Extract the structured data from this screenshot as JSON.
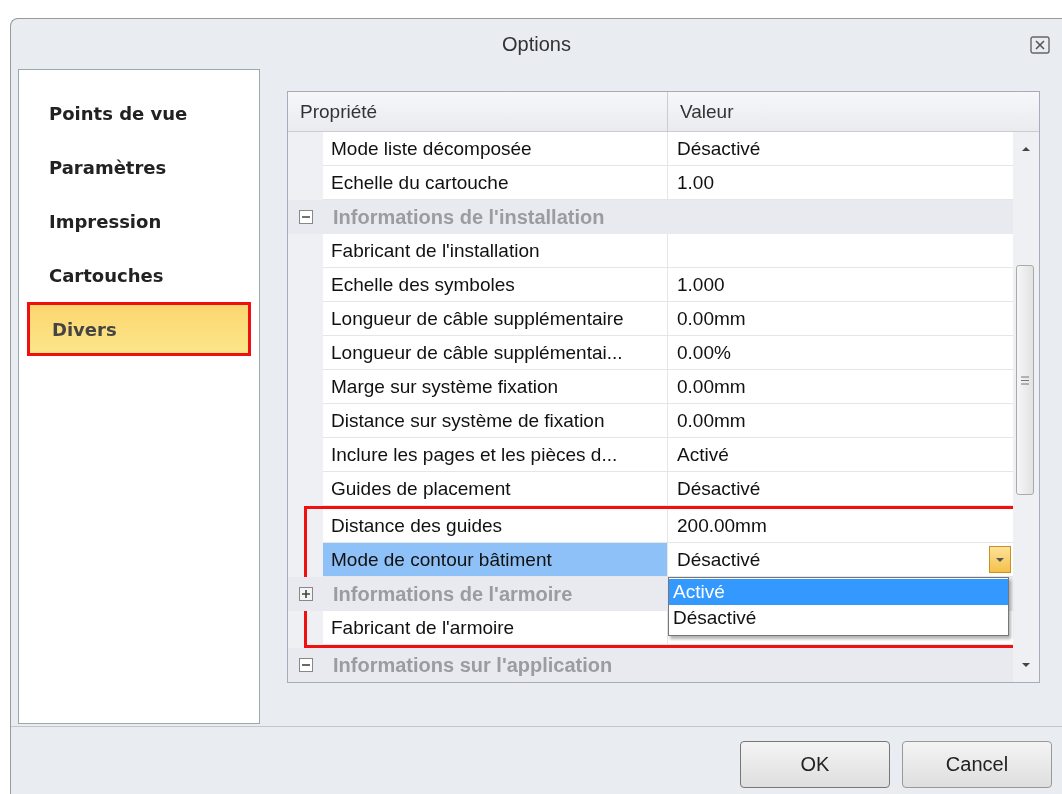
{
  "window": {
    "title": "Options"
  },
  "sidebar": {
    "items": [
      {
        "label": "Points de vue",
        "selected": false,
        "highlighted": false
      },
      {
        "label": "Paramètres",
        "selected": false,
        "highlighted": false
      },
      {
        "label": "Impression",
        "selected": false,
        "highlighted": false
      },
      {
        "label": "Cartouches",
        "selected": false,
        "highlighted": false
      },
      {
        "label": "Divers",
        "selected": true,
        "highlighted": true
      }
    ]
  },
  "grid": {
    "columns": [
      "Propriété",
      "Valeur"
    ],
    "rows": [
      {
        "kind": "property",
        "name": "Mode liste décomposée",
        "value": "Désactivé",
        "selected": false
      },
      {
        "kind": "property",
        "name": "Echelle du cartouche",
        "value": "1.00",
        "selected": false
      },
      {
        "kind": "category",
        "name": "Informations de l'installation",
        "expanded": true
      },
      {
        "kind": "property",
        "name": "Fabricant de l'installation",
        "selected": false
      },
      {
        "kind": "property",
        "name": "Echelle des symboles",
        "value": "1.000",
        "selected": false
      },
      {
        "kind": "property",
        "name": "Longueur de câble supplémentaire",
        "value": "0.00mm",
        "selected": false
      },
      {
        "kind": "property",
        "name": "Longueur de câble supplémentai...",
        "value": "0.00%",
        "selected": false
      },
      {
        "kind": "property",
        "name": "Marge sur système fixation",
        "value": "0.00mm",
        "selected": false
      },
      {
        "kind": "property",
        "name": "Distance sur système de fixation",
        "value": "0.00mm",
        "selected": false
      },
      {
        "kind": "property",
        "name": "Inclure les pages et les pièces d...",
        "value": "Activé",
        "selected": false
      },
      {
        "kind": "property",
        "name": "Guides de placement",
        "value": "Désactivé",
        "selected": false
      },
      {
        "kind": "highlight_group",
        "rows": [
          {
            "kind": "property",
            "name": "Distance des guides",
            "value": "200.00mm",
            "selected": false
          },
          {
            "kind": "property",
            "name": "Mode de contour bâtiment",
            "value": "Désactivé",
            "selected": true,
            "dropdown": {
              "open": true,
              "options": [
                {
                  "label": "Activé",
                  "selected": true
                },
                {
                  "label": "Désactivé",
                  "selected": false
                }
              ]
            }
          },
          {
            "kind": "category",
            "name": "Informations de l'armoire",
            "expanded": false
          },
          {
            "kind": "property",
            "name": "Fabricant de l'armoire",
            "selected": false
          }
        ]
      },
      {
        "kind": "category",
        "name": "Informations sur l'application",
        "expanded": true
      }
    ]
  },
  "buttons": [
    "OK",
    "Cancel"
  ]
}
